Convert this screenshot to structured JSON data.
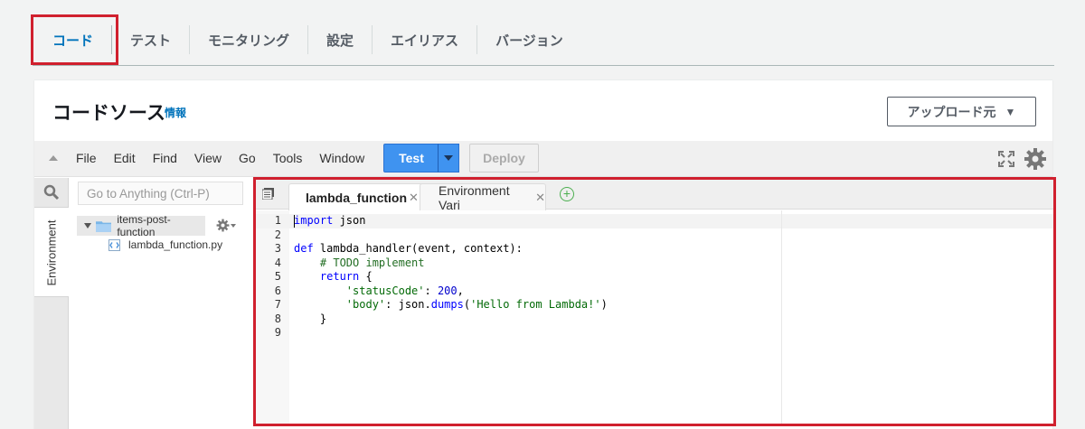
{
  "tabs": [
    {
      "label": "コード"
    },
    {
      "label": "テスト"
    },
    {
      "label": "モニタリング"
    },
    {
      "label": "設定"
    },
    {
      "label": "エイリアス"
    },
    {
      "label": "バージョン"
    }
  ],
  "panel": {
    "title": "コードソース",
    "info_link": "情報",
    "upload_button": "アップロード元"
  },
  "toolbar": {
    "menu": [
      "File",
      "Edit",
      "Find",
      "View",
      "Go",
      "Tools",
      "Window"
    ],
    "test_label": "Test",
    "deploy_label": "Deploy"
  },
  "sidebar": {
    "environment_label": "Environment",
    "goto_placeholder": "Go to Anything (Ctrl-P)",
    "folder_name": "items-post-function",
    "file_name": "lambda_function.py"
  },
  "editor": {
    "tabs": [
      {
        "label": "lambda_function"
      },
      {
        "label": "Environment Vari"
      }
    ]
  },
  "colors": {
    "accent": "#0073bb",
    "highlight_border": "#d0202e",
    "test_button": "#3f93f0"
  }
}
